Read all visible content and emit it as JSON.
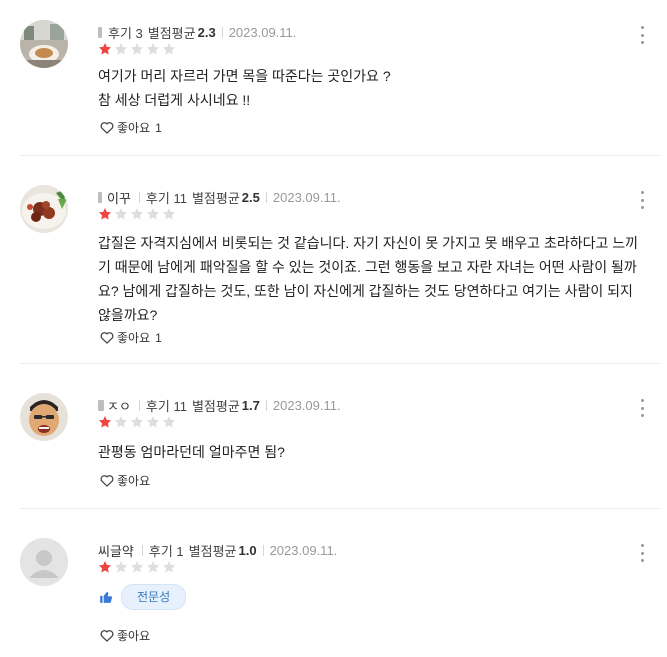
{
  "colors": {
    "star_filled": "#f04640",
    "star_empty": "#dedede",
    "chip_bg": "#e7f1fb",
    "chip_text": "#3776bf",
    "thumb_blue": "#3a7bd5"
  },
  "icons": {
    "more": "more-vertical-icon",
    "like": "heart-outline-icon",
    "thumb": "thumbs-up-icon",
    "star": "star-icon"
  },
  "reviews": [
    {
      "review_count_label": "후기 3",
      "avg_label": "별점평균",
      "avg_value": "2.3",
      "date": "2023.09.11.",
      "rating": 1,
      "rating_max": 5,
      "content": "여기가 머리 자르러 가면 목을 따준다는  곳인가요 ?\n참 세상 더럽게 사시네요 !!",
      "like_label": "좋아요",
      "like_count": "1"
    },
    {
      "nickname": "이꾸",
      "review_count_label": "후기 11",
      "avg_label": "별점평균",
      "avg_value": "2.5",
      "date": "2023.09.11.",
      "rating": 1,
      "rating_max": 5,
      "content": "갑질은 자격지심에서 비롯되는 것 같습니다. 자기 자신이 못 가지고 못 배우고 초라하다고 느끼기 때문에 남에게 패악질을 할 수 있는 것이죠. 그런 행동을 보고 자란 자녀는 어떤 사람이 될까요? 남에게 갑질하는 것도, 또한 남이 자신에게 갑질하는 것도 당연하다고 여기는 사람이 되지 않을까요?",
      "like_label": "좋아요",
      "like_count": "1"
    },
    {
      "nickname": "ㅈㅇ",
      "review_count_label": "후기 11",
      "avg_label": "별점평균",
      "avg_value": "1.7",
      "date": "2023.09.11.",
      "rating": 1,
      "rating_max": 5,
      "content": "관평동 엄마라던데 얼마주면 됨?",
      "like_label": "좋아요"
    },
    {
      "nickname": "씨글약",
      "review_count_label": "후기 1",
      "avg_label": "별점평균",
      "avg_value": "1.0",
      "date": "2023.09.11.",
      "rating": 1,
      "rating_max": 5,
      "tag": "전문성",
      "like_label": "좋아요"
    }
  ]
}
